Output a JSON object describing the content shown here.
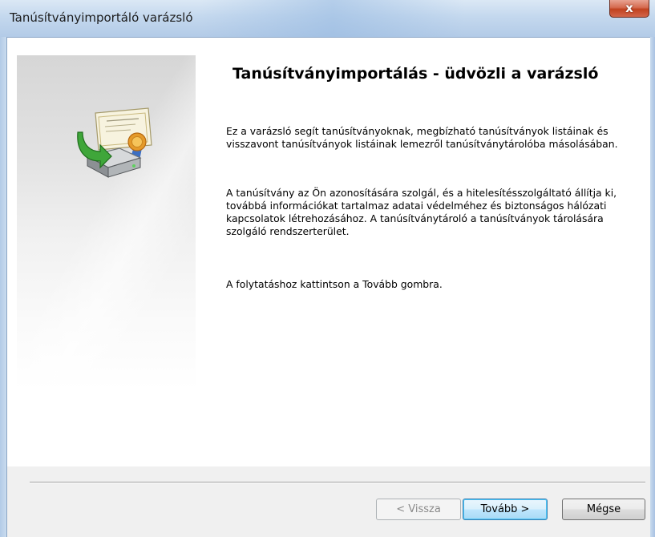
{
  "window": {
    "title": "Tanúsítványimportáló varázsló",
    "close_glyph": "x"
  },
  "wizard": {
    "heading": "Tanúsítványimportálás - üdvözli a varázsló",
    "paragraphs": [
      "Ez a varázsló segít tanúsítványoknak, megbízható tanúsítványok listáinak és visszavont tanúsítványok listáinak lemezről tanúsítványtárolóba másolásában.",
      "A tanúsítvány az Ön azonosítására szolgál, és a hitelesítésszolgáltató állítja ki, továbbá információkat tartalmaz adatai védelméhez és biztonságos hálózati kapcsolatok létrehozásához. A tanúsítványtároló a tanúsítványok tárolására szolgáló rendszerterület.",
      "A folytatáshoz kattintson a Tovább gombra."
    ],
    "icon": "certificate-import-icon"
  },
  "buttons": {
    "back": "< Vissza",
    "next": "Tovább >",
    "cancel": "Mégse"
  },
  "colors": {
    "titlebar": "#c4d8ee",
    "close_button": "#c1421f",
    "default_button_border": "#3c7fb1",
    "dialog_background": "#f0f0f0"
  }
}
